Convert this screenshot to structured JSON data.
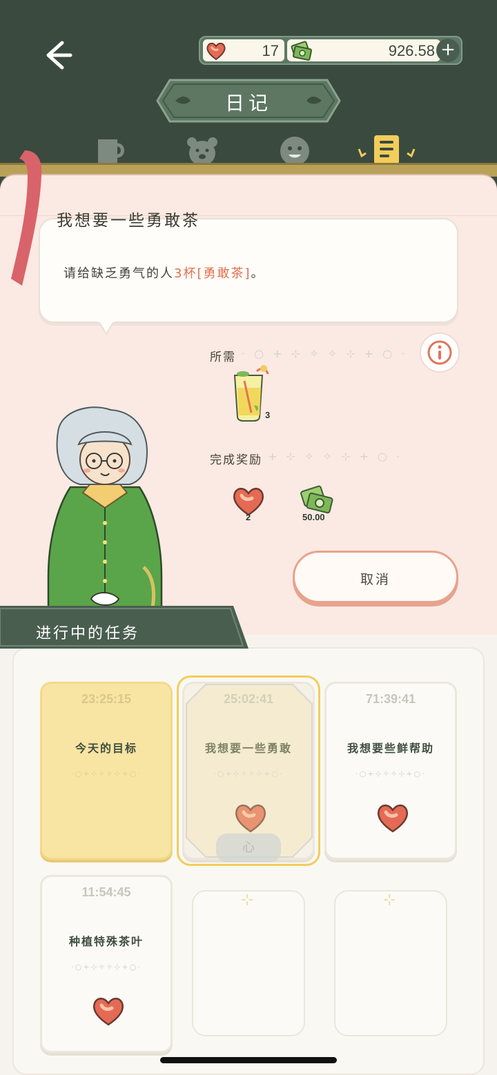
{
  "header": {
    "hearts": "17",
    "money": "926.58",
    "title": "日记",
    "plus": "+"
  },
  "tabs": [
    {
      "name": "cup-tab",
      "active": false
    },
    {
      "name": "bear-tab",
      "active": false
    },
    {
      "name": "face-tab",
      "active": false
    },
    {
      "name": "diary-tab",
      "active": true
    }
  ],
  "quest": {
    "title": "我想要一些勇敢茶",
    "request_prefix": "请给缺乏勇气的人",
    "request_highlight": "3杯[勇敢茶]",
    "request_suffix": "。",
    "required_label": "所需",
    "required_item": {
      "icon": "brave-tea-icon",
      "count": "3"
    },
    "reward_label": "完成奖励",
    "rewards": [
      {
        "icon": "heart-icon",
        "count": "2"
      },
      {
        "icon": "money-icon",
        "count": "50.00"
      }
    ],
    "cancel_label": "取消"
  },
  "section": {
    "label": "进行中的任务"
  },
  "tasks": [
    {
      "time": "23:25:15",
      "title": "今天的目标"
    },
    {
      "time": "25:02:41",
      "title": "我想要一些勇敢",
      "selected": true,
      "claim": "心"
    },
    {
      "time": "71:39:41",
      "title": "我想要些鲜帮助"
    },
    {
      "time": "11:54:45",
      "title": "种植特殊茶叶"
    }
  ],
  "colors": {
    "bg_dark": "#3a4a3f",
    "page_pink": "#fbe9e3",
    "accent_orange": "#e36f4d",
    "card_yellow": "#f8e4a3",
    "select_gold": "#f2cd5b"
  }
}
